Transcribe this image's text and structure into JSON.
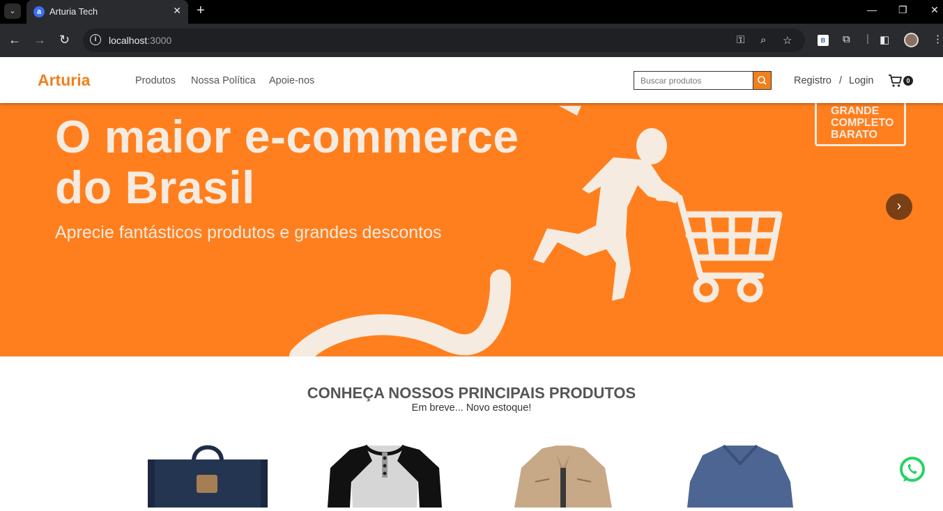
{
  "browser": {
    "tab_title": "Arturia Tech",
    "url_host": "localhost",
    "url_port": ":3000"
  },
  "header": {
    "brand": "Arturia",
    "nav": [
      "Produtos",
      "Nossa Política",
      "Apoie-nos"
    ],
    "search_placeholder": "Buscar produtos",
    "register": "Registro",
    "separator": "/",
    "login": "Login",
    "cart_count": "0"
  },
  "hero": {
    "title_line1": "O maior e-commerce",
    "title_line2": "do Brasil",
    "subtitle": "Aprecie fantásticos produtos e grandes descontos",
    "badge": [
      "GRANDE",
      "COMPLETO",
      "BARATO"
    ]
  },
  "products_section": {
    "title": "CONHEÇA NOSSOS PRINCIPAIS PRODUTOS",
    "subtitle": "Em breve... Novo estoque!"
  },
  "products": [
    {
      "icon": "navy-backpack-image"
    },
    {
      "icon": "raglan-henley-shirt-image"
    },
    {
      "icon": "khaki-jacket-image"
    },
    {
      "icon": "blue-vneck-sweater-image"
    }
  ],
  "colors": {
    "accent": "#f07f1c",
    "hero_bg": "#ff7f1e",
    "hero_text": "#f6ebe0"
  }
}
